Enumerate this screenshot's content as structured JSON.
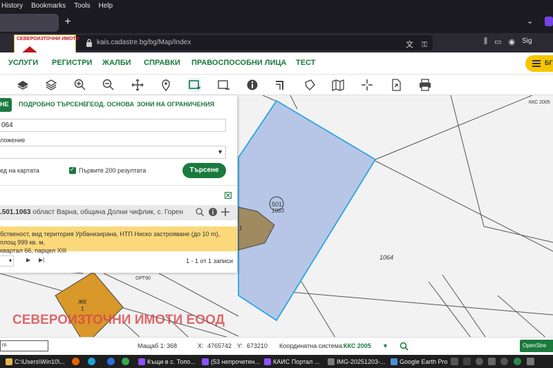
{
  "browser": {
    "menu": [
      "History",
      "Bookmarks",
      "Tools",
      "Help"
    ],
    "new_tab": "+",
    "url": "kais.cadastre.bg/bg/Map/Index",
    "profile_label": "Sig"
  },
  "logo": {
    "text": "СЕВЕРОИЗТОЧНИ ИМОТИ"
  },
  "site_nav": {
    "items": [
      "УСЛУГИ",
      "РЕГИСТРИ",
      "ЖАЛБИ",
      "СПРАВКИ",
      "ПРАВОСПОСОБНИ ЛИЦА",
      "ТЕСТ"
    ],
    "menu_lang": "БГ"
  },
  "toolbar": {
    "tools": [
      "layers-icon",
      "stack-icon",
      "zoom-in-icon",
      "zoom-out-icon",
      "pan-icon",
      "pin-icon",
      "select-rect-icon",
      "select-area-icon",
      "info-icon",
      "corner-icon",
      "polygon-icon",
      "map-icon",
      "crosshair-icon",
      "export-icon",
      "print-icon"
    ]
  },
  "panel": {
    "tabs": [
      "НЕ",
      "ПОДРОБНО ТЪРСЕНЕ",
      "ГЕОД. ОСНОВА",
      "ЗОНИ НА ОГРАНИЧЕНИЯ"
    ],
    "identifier_value": "064",
    "location_label": "ложение",
    "location_value": "",
    "show_on_map_label": "ед на картата",
    "first_200_label": "Първите 200 резултата",
    "search_button": "Търсене",
    "result": {
      "id": ".501.1063",
      "address": "област Варна, община Долни чифлик, с. Горен",
      "details_line1": "бственост, вид територия Урбанизирана, НТП Ниско застрояване (до 10 m), площ 999 кв. м,",
      "details_line2": "квартал 66, парцел XIII"
    },
    "pager_count": "1 - 1 от 1 записи"
  },
  "map": {
    "labels": {
      "parcel_no": "501",
      "parcel_id": "1063",
      "neighbor": "1064",
      "kks_corner": "ККС 2005",
      "building_num": "1",
      "orange_building_label": "ЖК",
      "orange_building_num": "1",
      "road_label": "ОРТ90"
    },
    "colors": {
      "parcel_fill": "#b7c6e6",
      "parcel_stroke": "#2aa6e0",
      "building_fill": "#a08a60",
      "orange_building": "#d9982a"
    }
  },
  "watermark": "СЕВЕРОИЗТОЧНИ ИМОТИ ЕООД",
  "status": {
    "scale_label": "Мащаб 1:",
    "scale_value": "368",
    "x_label": "X:",
    "x_value": "4765742",
    "y_label": "Y:",
    "y_value": "673210",
    "crs_label": "Координатна система:",
    "crs_value": "ККС 2005",
    "scalebar": "m",
    "osm": "OpenStre"
  },
  "taskbar": {
    "items": [
      "C:\\Users\\Win10\\...",
      "Къщи в с. Топо...",
      "(53 непрочетен...",
      "КАИС Портал ...",
      "IMG-20251203-...",
      "Google Earth Pro"
    ]
  }
}
